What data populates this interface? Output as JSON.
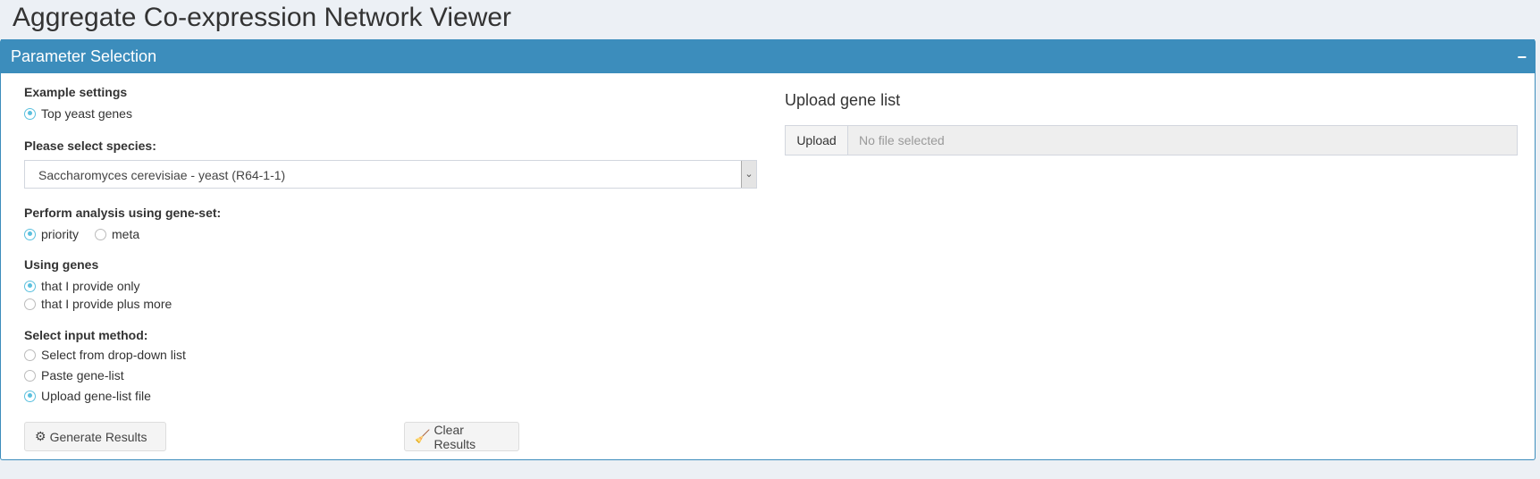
{
  "app": {
    "title": "Aggregate Co-expression Network Viewer"
  },
  "panel": {
    "title": "Parameter Selection",
    "collapse_icon": "minus-icon",
    "accent_color": "#3c8dbc",
    "example": {
      "label": "Example settings",
      "options": [
        {
          "label": "Top yeast genes",
          "selected": true
        }
      ]
    },
    "species": {
      "label": "Please select species:",
      "value": "Saccharomyces cerevisiae - yeast (R64-1-1)"
    },
    "geneset": {
      "label": "Perform analysis using gene-set:",
      "options": [
        {
          "label": "priority",
          "selected": true
        },
        {
          "label": "meta",
          "selected": false
        }
      ]
    },
    "using": {
      "label": "Using genes",
      "options": [
        {
          "label": "that I provide only",
          "selected": true
        },
        {
          "label": "that I provide plus more",
          "selected": false
        }
      ]
    },
    "input_method": {
      "label": "Select input method:",
      "options": [
        {
          "label": "Select from drop-down list",
          "selected": false
        },
        {
          "label": "Paste gene-list",
          "selected": false
        },
        {
          "label": "Upload gene-list file",
          "selected": true
        }
      ]
    },
    "generate_label": "Generate Results",
    "clear_label": "Clear Results",
    "upload": {
      "title": "Upload gene list",
      "button": "Upload",
      "placeholder": "No file selected"
    }
  }
}
